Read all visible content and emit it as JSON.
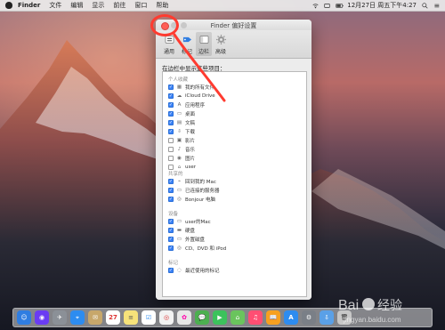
{
  "menubar": {
    "app": "Finder",
    "items": [
      "文件",
      "编辑",
      "显示",
      "前往",
      "窗口",
      "帮助"
    ],
    "datetime": "12月27日 周五下午4:27"
  },
  "window": {
    "title": "Finder 偏好设置",
    "toolbar": [
      {
        "label": "通用",
        "icon": "switch-icon"
      },
      {
        "label": "标记",
        "icon": "tag-icon"
      },
      {
        "label": "边栏",
        "icon": "sidebar-icon"
      },
      {
        "label": "高级",
        "icon": "gear-icon"
      }
    ],
    "selected_tab": "边栏",
    "heading": "在边栏中显示这些项目：",
    "groups": [
      {
        "label": "个人收藏",
        "items": [
          {
            "label": "我的所有文件",
            "checked": true,
            "icon": "files-icon"
          },
          {
            "label": "iCloud Drive",
            "checked": true,
            "icon": "cloud-icon"
          },
          {
            "label": "应用程序",
            "checked": true,
            "icon": "apps-icon"
          },
          {
            "label": "桌面",
            "checked": true,
            "icon": "desktop-icon"
          },
          {
            "label": "文稿",
            "checked": true,
            "icon": "document-icon"
          },
          {
            "label": "下载",
            "checked": true,
            "icon": "download-icon"
          },
          {
            "label": "影片",
            "checked": false,
            "icon": "movie-icon"
          },
          {
            "label": "音乐",
            "checked": false,
            "icon": "music-icon"
          },
          {
            "label": "图片",
            "checked": false,
            "icon": "camera-icon"
          },
          {
            "label": "user",
            "checked": false,
            "icon": "home-icon"
          }
        ]
      },
      {
        "label": "共享的",
        "items": [
          {
            "label": "回到我的 Mac",
            "checked": true,
            "icon": "back-to-mac-icon"
          },
          {
            "label": "已连接的服务器",
            "checked": true,
            "icon": "server-icon"
          },
          {
            "label": "Bonjour 电脑",
            "checked": true,
            "icon": "bonjour-icon"
          }
        ]
      },
      {
        "label": "设备",
        "items": [
          {
            "label": "user的Mac",
            "checked": true,
            "icon": "computer-icon"
          },
          {
            "label": "硬盘",
            "checked": true,
            "icon": "harddrive-icon"
          },
          {
            "label": "外置磁盘",
            "checked": true,
            "icon": "externaldisk-icon"
          },
          {
            "label": "CD、DVD 和 iPod",
            "checked": true,
            "icon": "cd-icon"
          }
        ]
      },
      {
        "label": "标记",
        "items": [
          {
            "label": "最近使用的标记",
            "checked": true,
            "icon": "tag-outline-icon"
          }
        ]
      }
    ]
  },
  "dock": {
    "apps": [
      {
        "name": "finder",
        "color": "#2f7de1",
        "glyph": "☺"
      },
      {
        "name": "siri",
        "color": "#6a3cf3",
        "glyph": "◉"
      },
      {
        "name": "launchpad",
        "color": "#8b9097",
        "glyph": "✈"
      },
      {
        "name": "safari",
        "color": "#2d8cf0",
        "glyph": "⌖"
      },
      {
        "name": "mail-stamp",
        "color": "#c7a76b",
        "glyph": "✉"
      },
      {
        "name": "calendar",
        "color": "#ffffff",
        "glyph": "27"
      },
      {
        "name": "notes",
        "color": "#f6e27a",
        "glyph": "≡"
      },
      {
        "name": "reminders",
        "color": "#ffffff",
        "glyph": "☑"
      },
      {
        "name": "photos-app",
        "color": "#f2f2f2",
        "glyph": "◎"
      },
      {
        "name": "photos",
        "color": "#e7e7e7",
        "glyph": "✿"
      },
      {
        "name": "messages",
        "color": "#4caf50",
        "glyph": "💬"
      },
      {
        "name": "facetime",
        "color": "#3cc25c",
        "glyph": "▶"
      },
      {
        "name": "maps",
        "color": "#6ac45d",
        "glyph": "⌂"
      },
      {
        "name": "music",
        "color": "#ff4e73",
        "glyph": "♫"
      },
      {
        "name": "books",
        "color": "#f6a020",
        "glyph": "📖"
      },
      {
        "name": "appstore",
        "color": "#2d8cf0",
        "glyph": "A"
      },
      {
        "name": "system-preferences",
        "color": "#7a7f87",
        "glyph": "⚙"
      },
      {
        "name": "downloads",
        "color": "#5aa0e7",
        "glyph": "⇩"
      },
      {
        "name": "trash",
        "color": "#c7c7c7",
        "glyph": "🗑"
      }
    ]
  },
  "watermark": {
    "text": "Baidu 经验",
    "subtext": "jingyan.baidu.com"
  },
  "colors": {
    "accent": "#3b82f6",
    "close": "#ff5f57",
    "annotation": "#ff3b30"
  }
}
